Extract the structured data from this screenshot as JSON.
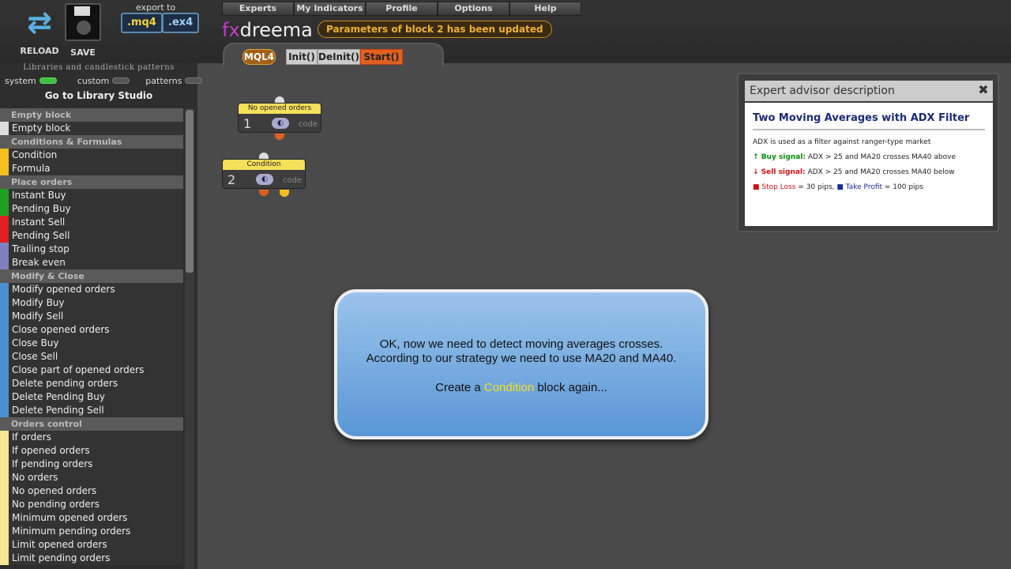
{
  "toolbar": {
    "reload_label": "RELOAD",
    "save_label": "SAVE",
    "export_to": "export to",
    "export_mq4": ".mq4",
    "export_ex4": ".ex4"
  },
  "menu": [
    "Experts",
    "My Indicators",
    "Profile",
    "Options",
    "Help"
  ],
  "logo": {
    "fx": "fx",
    "dreema": "dreema"
  },
  "notice": "Parameters of block 2 has been updated",
  "tabs": {
    "mql4": "MQL4",
    "init": "Init()",
    "deinit": "DeInit()",
    "start": "Start()"
  },
  "sidebar": {
    "title": "Libraries and candlestick patterns",
    "toggles": {
      "system": "system",
      "custom": "custom",
      "patterns": "patterns"
    },
    "goto_studio": "Go to Library Studio",
    "sections": [
      {
        "name": "Empty block",
        "items": [
          "Empty block"
        ]
      },
      {
        "name": "Conditions & Formulas",
        "items": [
          "Condition",
          "Formula"
        ]
      },
      {
        "name": "Place orders",
        "items": [
          "Instant Buy",
          "Pending Buy",
          "Instant Sell",
          "Pending Sell",
          "Trailing stop",
          "Break even"
        ]
      },
      {
        "name": "Modify & Close",
        "items": [
          "Modify opened orders",
          "Modify Buy",
          "Modify Sell",
          "Close opened orders",
          "Close Buy",
          "Close Sell",
          "Close part of opened orders",
          "Delete pending orders",
          "Delete Pending Buy",
          "Delete Pending Sell"
        ]
      },
      {
        "name": "Orders control",
        "items": [
          "If orders",
          "If opened orders",
          "If pending orders",
          "No orders",
          "No opened orders",
          "No pending orders",
          "Minimum opened orders",
          "Minimum pending orders",
          "Limit opened orders",
          "Limit pending orders"
        ]
      }
    ]
  },
  "blocks": [
    {
      "title": "No opened orders",
      "num": "1",
      "code": "code"
    },
    {
      "title": "Condition",
      "num": "2",
      "code": "code"
    }
  ],
  "description": {
    "header": "Expert advisor description",
    "title": "Two Moving Averages with ADX Filter",
    "line1": "ADX is used as a filter against ranger-type market",
    "buy_label": "Buy signal:",
    "buy_text": " ADX > 25 and MA20 crosses MA40 above",
    "sell_label": "Sell signal:",
    "sell_text": " ADX > 25 and MA20 crosses MA40 below",
    "sl_label": "Stop Loss",
    "sl_text": " = 30 pips, ",
    "tp_label": "Take Profit",
    "tp_text": " = 100 pips"
  },
  "bubble": {
    "line1": "OK, now we need to detect moving averages crosses.",
    "line2": "According to our strategy we need to use MA20 and MA40.",
    "line3_pre": "Create a ",
    "line3_hl": "Condition",
    "line3_post": " block again..."
  },
  "colors": {
    "empty": "#dddddd",
    "condition": "#f5c020",
    "buy": "#20a020",
    "sell": "#e02020",
    "trail": "#8080c0",
    "modify": "#4a90d0",
    "control": "#f5e890"
  }
}
